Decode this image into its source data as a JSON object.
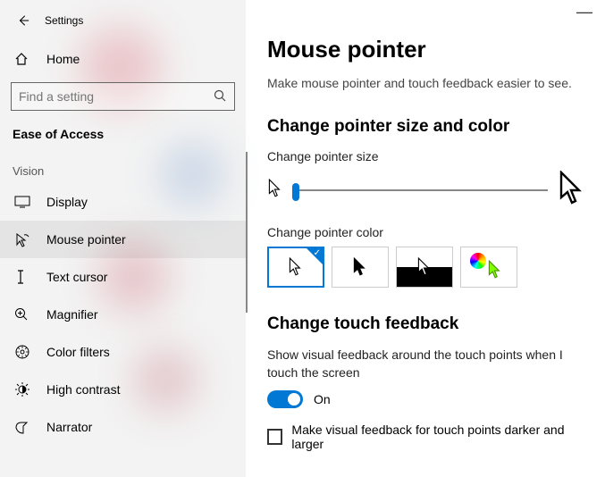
{
  "app": {
    "title": "Settings"
  },
  "sidebar": {
    "home": "Home",
    "search_placeholder": "Find a setting",
    "section": "Ease of Access",
    "group": "Vision",
    "items": [
      {
        "label": "Display"
      },
      {
        "label": "Mouse pointer"
      },
      {
        "label": "Text cursor"
      },
      {
        "label": "Magnifier"
      },
      {
        "label": "Color filters"
      },
      {
        "label": "High contrast"
      },
      {
        "label": "Narrator"
      }
    ]
  },
  "page": {
    "title": "Mouse pointer",
    "subtitle": "Make mouse pointer and touch feedback easier to see.",
    "section_size": "Change pointer size and color",
    "label_size": "Change pointer size",
    "label_color": "Change pointer color",
    "section_touch": "Change touch feedback",
    "touch_desc": "Show visual feedback around the touch points when I touch the screen",
    "toggle_label": "On",
    "checkbox_label": "Make visual feedback for touch points darker and larger"
  }
}
